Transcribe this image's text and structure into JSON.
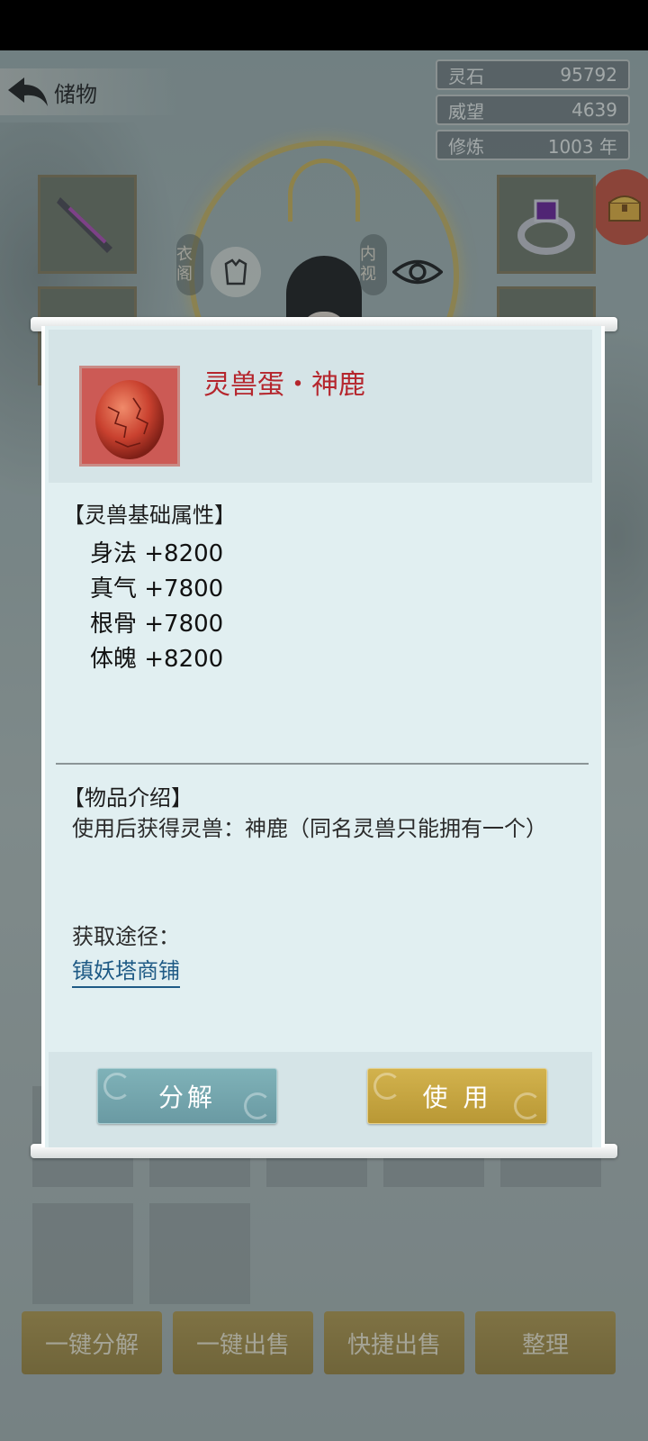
{
  "header": {
    "title": "储物"
  },
  "stats": [
    {
      "label": "灵石",
      "value": "95792"
    },
    {
      "label": "威望",
      "value": "4639"
    },
    {
      "label": "修炼",
      "value": "1003 年"
    }
  ],
  "character_panel": {
    "left_tag": "衣阁",
    "right_tag": "内视"
  },
  "item": {
    "name": "灵兽蛋・神鹿",
    "attributes_title": "【灵兽基础属性】",
    "attributes": [
      {
        "text": "身法 +8200"
      },
      {
        "text": "真气 +7800"
      },
      {
        "text": "根骨 +7800"
      },
      {
        "text": "体魄 +8200"
      }
    ],
    "intro_title": "【物品介绍】",
    "description": "使用后获得灵兽：神鹿（同名灵兽只能拥有一个）",
    "source_label": "获取途径：",
    "source_link": "镇妖塔商铺",
    "decompose_label": "分解",
    "use_label": "使 用"
  },
  "bottom_actions": {
    "one_click_decompose": "一键分解",
    "one_click_sell": "一键出售",
    "quick_sell": "快捷出售",
    "sort": "整理"
  },
  "icons": [
    "back-arrow-icon",
    "weapon-icon",
    "ring-icon",
    "treasure-chest-icon",
    "robe-icon",
    "eye-icon",
    "plus-icon",
    "spirit-egg-icon"
  ],
  "colors": {
    "item_name": "#b5262d",
    "link": "#1e5a85",
    "decompose_button": "#6a9aa3",
    "use_button": "#c5a441"
  }
}
